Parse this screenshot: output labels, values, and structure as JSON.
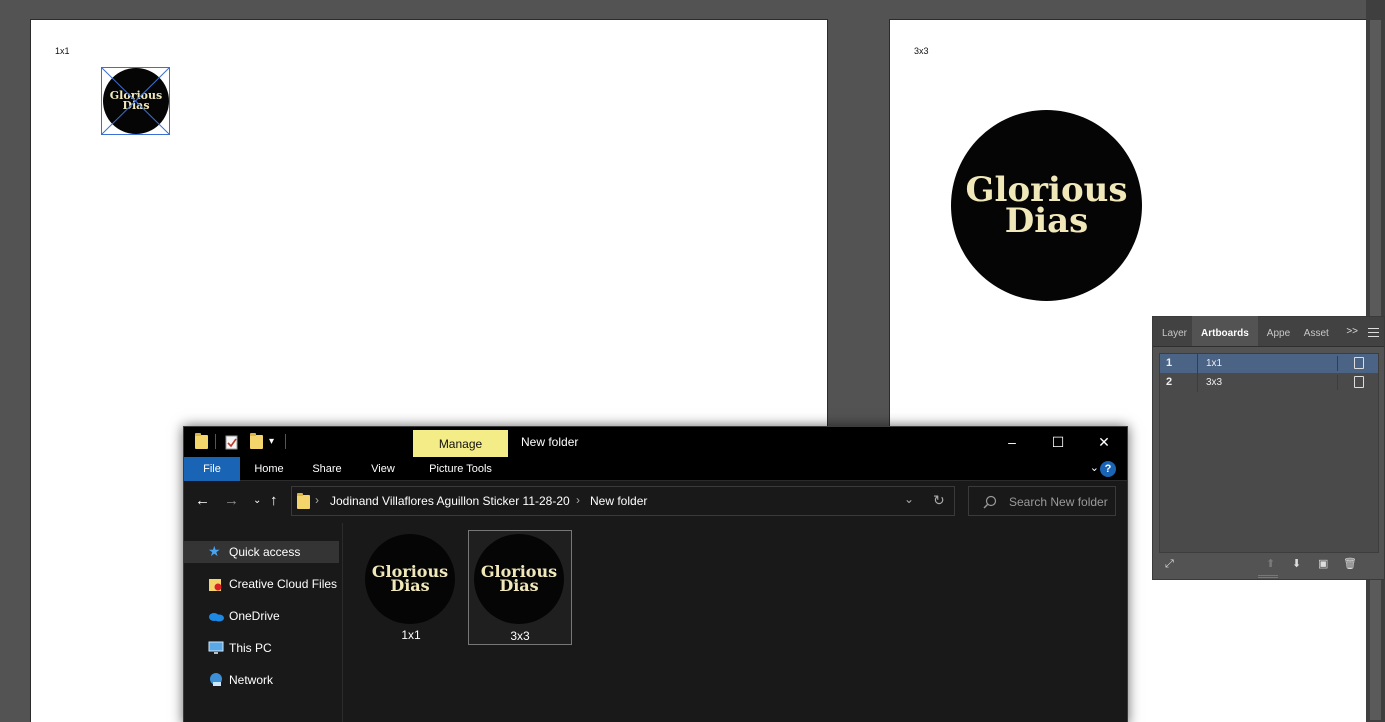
{
  "canvas": {
    "artboard1_label": "1x1",
    "artboard2_label": "3x3",
    "sticker_line1": "Glorious",
    "sticker_line2": "Dias"
  },
  "artboards_panel": {
    "tabs": [
      "Layer",
      "Artboards",
      "Appe",
      "Asset"
    ],
    "overflow": ">>",
    "rows": [
      {
        "num": "1",
        "name": "1x1"
      },
      {
        "num": "2",
        "name": "3x3"
      }
    ]
  },
  "explorer": {
    "manage_tab": "Manage",
    "window_title": "New folder",
    "ribbon_tabs": [
      "File",
      "Home",
      "Share",
      "View",
      "Picture Tools"
    ],
    "help": "?",
    "breadcrumb": [
      "Jodinand Villaflores Aguillon Sticker 11-28-20",
      "New folder"
    ],
    "search_placeholder": "Search New folder",
    "nav_items": [
      "Quick access",
      "Creative Cloud Files",
      "OneDrive",
      "This PC",
      "Network"
    ],
    "files": [
      {
        "name": "1x1",
        "line1": "Glorious",
        "line2": "Dias"
      },
      {
        "name": "3x3",
        "line1": "Glorious",
        "line2": "Dias"
      }
    ]
  },
  "colors": {
    "sticker_bg": "#050505",
    "sticker_text": "#f1e8b9",
    "manage_tab": "#f4ec86",
    "file_tab": "#1a64b5",
    "selection_blue": "#3b6fd4",
    "panel_selected_row": "#4b6486"
  }
}
